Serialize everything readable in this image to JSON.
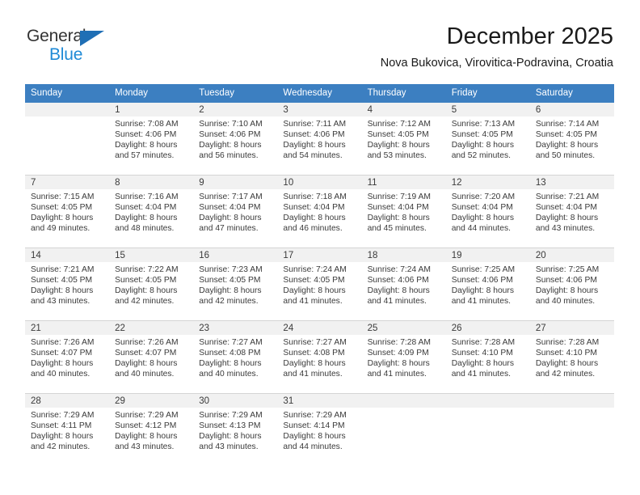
{
  "brand": {
    "name_part1": "General",
    "name_part2": "Blue",
    "triangle_color": "#1f6fb5",
    "blue_color": "#1f8ad6"
  },
  "header": {
    "title": "December 2025",
    "subtitle": "Nova Bukovica, Virovitica-Podravina, Croatia",
    "header_bg": "#3c7fc1"
  },
  "weekday_headers": [
    "Sunday",
    "Monday",
    "Tuesday",
    "Wednesday",
    "Thursday",
    "Friday",
    "Saturday"
  ],
  "weeks": [
    [
      {
        "day": "",
        "lines": []
      },
      {
        "day": "1",
        "lines": [
          "Sunrise: 7:08 AM",
          "Sunset: 4:06 PM",
          "Daylight: 8 hours",
          "and 57 minutes."
        ]
      },
      {
        "day": "2",
        "lines": [
          "Sunrise: 7:10 AM",
          "Sunset: 4:06 PM",
          "Daylight: 8 hours",
          "and 56 minutes."
        ]
      },
      {
        "day": "3",
        "lines": [
          "Sunrise: 7:11 AM",
          "Sunset: 4:06 PM",
          "Daylight: 8 hours",
          "and 54 minutes."
        ]
      },
      {
        "day": "4",
        "lines": [
          "Sunrise: 7:12 AM",
          "Sunset: 4:05 PM",
          "Daylight: 8 hours",
          "and 53 minutes."
        ]
      },
      {
        "day": "5",
        "lines": [
          "Sunrise: 7:13 AM",
          "Sunset: 4:05 PM",
          "Daylight: 8 hours",
          "and 52 minutes."
        ]
      },
      {
        "day": "6",
        "lines": [
          "Sunrise: 7:14 AM",
          "Sunset: 4:05 PM",
          "Daylight: 8 hours",
          "and 50 minutes."
        ]
      }
    ],
    [
      {
        "day": "7",
        "lines": [
          "Sunrise: 7:15 AM",
          "Sunset: 4:05 PM",
          "Daylight: 8 hours",
          "and 49 minutes."
        ]
      },
      {
        "day": "8",
        "lines": [
          "Sunrise: 7:16 AM",
          "Sunset: 4:04 PM",
          "Daylight: 8 hours",
          "and 48 minutes."
        ]
      },
      {
        "day": "9",
        "lines": [
          "Sunrise: 7:17 AM",
          "Sunset: 4:04 PM",
          "Daylight: 8 hours",
          "and 47 minutes."
        ]
      },
      {
        "day": "10",
        "lines": [
          "Sunrise: 7:18 AM",
          "Sunset: 4:04 PM",
          "Daylight: 8 hours",
          "and 46 minutes."
        ]
      },
      {
        "day": "11",
        "lines": [
          "Sunrise: 7:19 AM",
          "Sunset: 4:04 PM",
          "Daylight: 8 hours",
          "and 45 minutes."
        ]
      },
      {
        "day": "12",
        "lines": [
          "Sunrise: 7:20 AM",
          "Sunset: 4:04 PM",
          "Daylight: 8 hours",
          "and 44 minutes."
        ]
      },
      {
        "day": "13",
        "lines": [
          "Sunrise: 7:21 AM",
          "Sunset: 4:04 PM",
          "Daylight: 8 hours",
          "and 43 minutes."
        ]
      }
    ],
    [
      {
        "day": "14",
        "lines": [
          "Sunrise: 7:21 AM",
          "Sunset: 4:05 PM",
          "Daylight: 8 hours",
          "and 43 minutes."
        ]
      },
      {
        "day": "15",
        "lines": [
          "Sunrise: 7:22 AM",
          "Sunset: 4:05 PM",
          "Daylight: 8 hours",
          "and 42 minutes."
        ]
      },
      {
        "day": "16",
        "lines": [
          "Sunrise: 7:23 AM",
          "Sunset: 4:05 PM",
          "Daylight: 8 hours",
          "and 42 minutes."
        ]
      },
      {
        "day": "17",
        "lines": [
          "Sunrise: 7:24 AM",
          "Sunset: 4:05 PM",
          "Daylight: 8 hours",
          "and 41 minutes."
        ]
      },
      {
        "day": "18",
        "lines": [
          "Sunrise: 7:24 AM",
          "Sunset: 4:06 PM",
          "Daylight: 8 hours",
          "and 41 minutes."
        ]
      },
      {
        "day": "19",
        "lines": [
          "Sunrise: 7:25 AM",
          "Sunset: 4:06 PM",
          "Daylight: 8 hours",
          "and 41 minutes."
        ]
      },
      {
        "day": "20",
        "lines": [
          "Sunrise: 7:25 AM",
          "Sunset: 4:06 PM",
          "Daylight: 8 hours",
          "and 40 minutes."
        ]
      }
    ],
    [
      {
        "day": "21",
        "lines": [
          "Sunrise: 7:26 AM",
          "Sunset: 4:07 PM",
          "Daylight: 8 hours",
          "and 40 minutes."
        ]
      },
      {
        "day": "22",
        "lines": [
          "Sunrise: 7:26 AM",
          "Sunset: 4:07 PM",
          "Daylight: 8 hours",
          "and 40 minutes."
        ]
      },
      {
        "day": "23",
        "lines": [
          "Sunrise: 7:27 AM",
          "Sunset: 4:08 PM",
          "Daylight: 8 hours",
          "and 40 minutes."
        ]
      },
      {
        "day": "24",
        "lines": [
          "Sunrise: 7:27 AM",
          "Sunset: 4:08 PM",
          "Daylight: 8 hours",
          "and 41 minutes."
        ]
      },
      {
        "day": "25",
        "lines": [
          "Sunrise: 7:28 AM",
          "Sunset: 4:09 PM",
          "Daylight: 8 hours",
          "and 41 minutes."
        ]
      },
      {
        "day": "26",
        "lines": [
          "Sunrise: 7:28 AM",
          "Sunset: 4:10 PM",
          "Daylight: 8 hours",
          "and 41 minutes."
        ]
      },
      {
        "day": "27",
        "lines": [
          "Sunrise: 7:28 AM",
          "Sunset: 4:10 PM",
          "Daylight: 8 hours",
          "and 42 minutes."
        ]
      }
    ],
    [
      {
        "day": "28",
        "lines": [
          "Sunrise: 7:29 AM",
          "Sunset: 4:11 PM",
          "Daylight: 8 hours",
          "and 42 minutes."
        ]
      },
      {
        "day": "29",
        "lines": [
          "Sunrise: 7:29 AM",
          "Sunset: 4:12 PM",
          "Daylight: 8 hours",
          "and 43 minutes."
        ]
      },
      {
        "day": "30",
        "lines": [
          "Sunrise: 7:29 AM",
          "Sunset: 4:13 PM",
          "Daylight: 8 hours",
          "and 43 minutes."
        ]
      },
      {
        "day": "31",
        "lines": [
          "Sunrise: 7:29 AM",
          "Sunset: 4:14 PM",
          "Daylight: 8 hours",
          "and 44 minutes."
        ]
      },
      {
        "day": "",
        "lines": []
      },
      {
        "day": "",
        "lines": []
      },
      {
        "day": "",
        "lines": []
      }
    ]
  ]
}
